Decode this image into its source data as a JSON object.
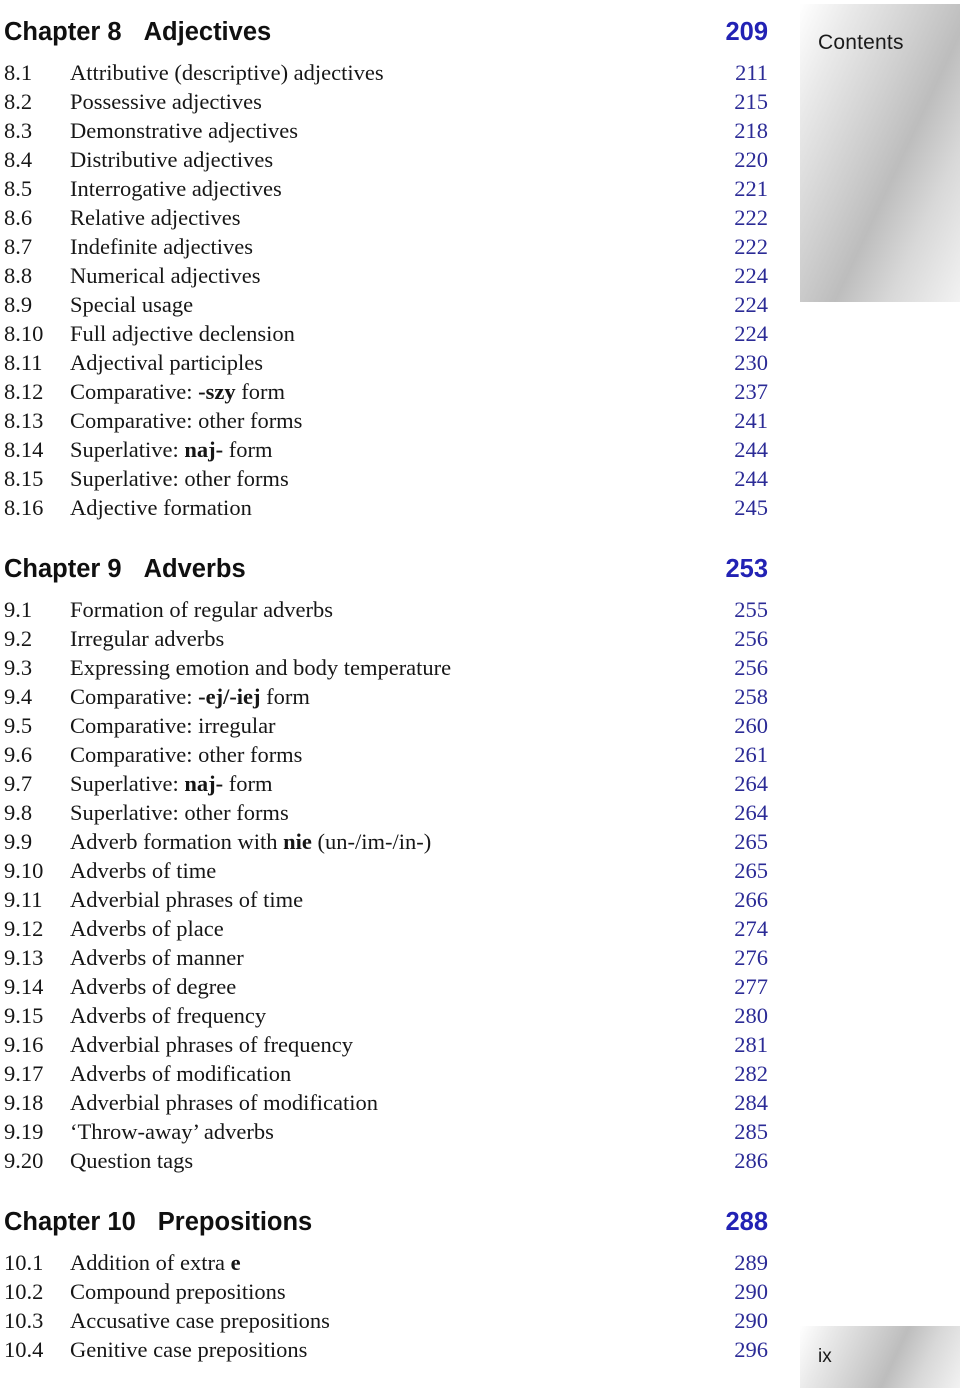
{
  "page": {
    "tab_label": "Contents",
    "folio": "ix"
  },
  "chapters": [
    {
      "label": "Chapter 8",
      "title": "Adjectives",
      "page": "209",
      "entries": [
        {
          "num": "8.1",
          "title": "Attributive (descriptive) adjectives",
          "page": "211"
        },
        {
          "num": "8.2",
          "title": "Possessive adjectives",
          "page": "215"
        },
        {
          "num": "8.3",
          "title": "Demonstrative adjectives",
          "page": "218"
        },
        {
          "num": "8.4",
          "title": "Distributive adjectives",
          "page": "220"
        },
        {
          "num": "8.5",
          "title": "Interrogative adjectives",
          "page": "221"
        },
        {
          "num": "8.6",
          "title": "Relative adjectives",
          "page": "222"
        },
        {
          "num": "8.7",
          "title": "Indefinite adjectives",
          "page": "222"
        },
        {
          "num": "8.8",
          "title": "Numerical adjectives",
          "page": "224"
        },
        {
          "num": "8.9",
          "title": "Special usage",
          "page": "224"
        },
        {
          "num": "8.10",
          "title": "Full adjective declension",
          "page": "224"
        },
        {
          "num": "8.11",
          "title": "Adjectival participles",
          "page": "230"
        },
        {
          "num": "8.12",
          "title": "Comparative: <b>-szy</b> form",
          "page": "237"
        },
        {
          "num": "8.13",
          "title": "Comparative: other forms",
          "page": "241"
        },
        {
          "num": "8.14",
          "title": "Superlative: <b>naj-</b> form",
          "page": "244"
        },
        {
          "num": "8.15",
          "title": "Superlative: other forms",
          "page": "244"
        },
        {
          "num": "8.16",
          "title": "Adjective formation",
          "page": "245"
        }
      ]
    },
    {
      "label": "Chapter 9",
      "title": "Adverbs",
      "page": "253",
      "entries": [
        {
          "num": "9.1",
          "title": "Formation of regular adverbs",
          "page": "255"
        },
        {
          "num": "9.2",
          "title": "Irregular adverbs",
          "page": "256"
        },
        {
          "num": "9.3",
          "title": "Expressing emotion and body temperature",
          "page": "256"
        },
        {
          "num": "9.4",
          "title": "Comparative: <b>-ej/-iej</b> form",
          "page": "258"
        },
        {
          "num": "9.5",
          "title": "Comparative: irregular",
          "page": "260"
        },
        {
          "num": "9.6",
          "title": "Comparative: other forms",
          "page": "261"
        },
        {
          "num": "9.7",
          "title": "Superlative: <b>naj-</b> form",
          "page": "264"
        },
        {
          "num": "9.8",
          "title": "Superlative: other forms",
          "page": "264"
        },
        {
          "num": "9.9",
          "title": "Adverb formation with <b>nie</b> (un-/im-/in-)",
          "page": "265"
        },
        {
          "num": "9.10",
          "title": "Adverbs of time",
          "page": "265"
        },
        {
          "num": "9.11",
          "title": "Adverbial phrases of time",
          "page": "266"
        },
        {
          "num": "9.12",
          "title": "Adverbs of place",
          "page": "274"
        },
        {
          "num": "9.13",
          "title": "Adverbs of manner",
          "page": "276"
        },
        {
          "num": "9.14",
          "title": "Adverbs of degree",
          "page": "277"
        },
        {
          "num": "9.15",
          "title": "Adverbs of frequency",
          "page": "280"
        },
        {
          "num": "9.16",
          "title": "Adverbial phrases of frequency",
          "page": "281"
        },
        {
          "num": "9.17",
          "title": "Adverbs of modification",
          "page": "282"
        },
        {
          "num": "9.18",
          "title": "Adverbial phrases of modification",
          "page": "284"
        },
        {
          "num": "9.19",
          "title": "‘Throw-away’ adverbs",
          "page": "285"
        },
        {
          "num": "9.20",
          "title": "Question tags",
          "page": "286"
        }
      ]
    },
    {
      "label": "Chapter 10",
      "title": "Prepositions",
      "page": "288",
      "entries": [
        {
          "num": "10.1",
          "title": "Addition of extra <b>e</b>",
          "page": "289"
        },
        {
          "num": "10.2",
          "title": "Compound prepositions",
          "page": "290"
        },
        {
          "num": "10.3",
          "title": "Accusative case prepositions",
          "page": "290"
        },
        {
          "num": "10.4",
          "title": "Genitive case prepositions",
          "page": "296"
        }
      ]
    }
  ]
}
